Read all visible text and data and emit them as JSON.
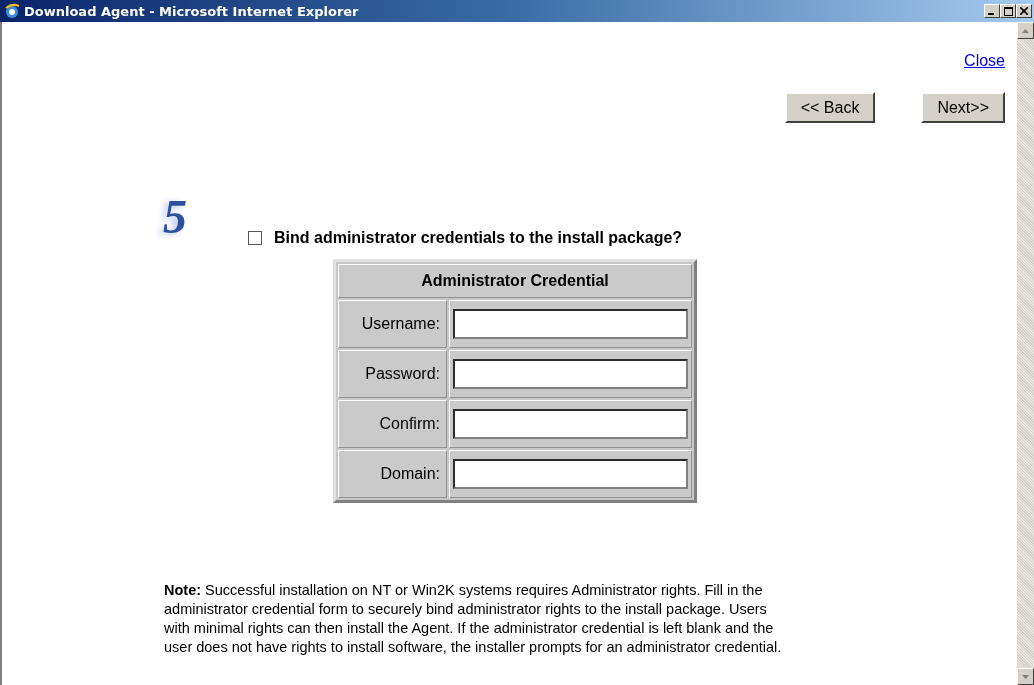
{
  "window": {
    "title": "Download Agent - Microsoft Internet Explorer"
  },
  "close_link": "Close",
  "buttons": [
    {
      "label": "<< Back"
    },
    {
      "label": "Next>>"
    }
  ],
  "step_number": "5",
  "bind_option": {
    "label": "Bind administrator credentials to the install package?",
    "checked": false
  },
  "credential_table": {
    "title": "Administrator Credential",
    "fields": [
      {
        "label": "Username:"
      },
      {
        "label": "Password:"
      },
      {
        "label": "Confirm:"
      },
      {
        "label": "Domain:"
      }
    ]
  },
  "note": "**Note:** Successful installation on NT or Win2K systems requires Administrator rights. Fill in the administrator credential form to securely bind administrator rights to the install package. Users with minimal rights can then install the Agent. If the administrator credential is left blank and the user does not have rights to install software, the installer prompts for an administrator credential."
}
